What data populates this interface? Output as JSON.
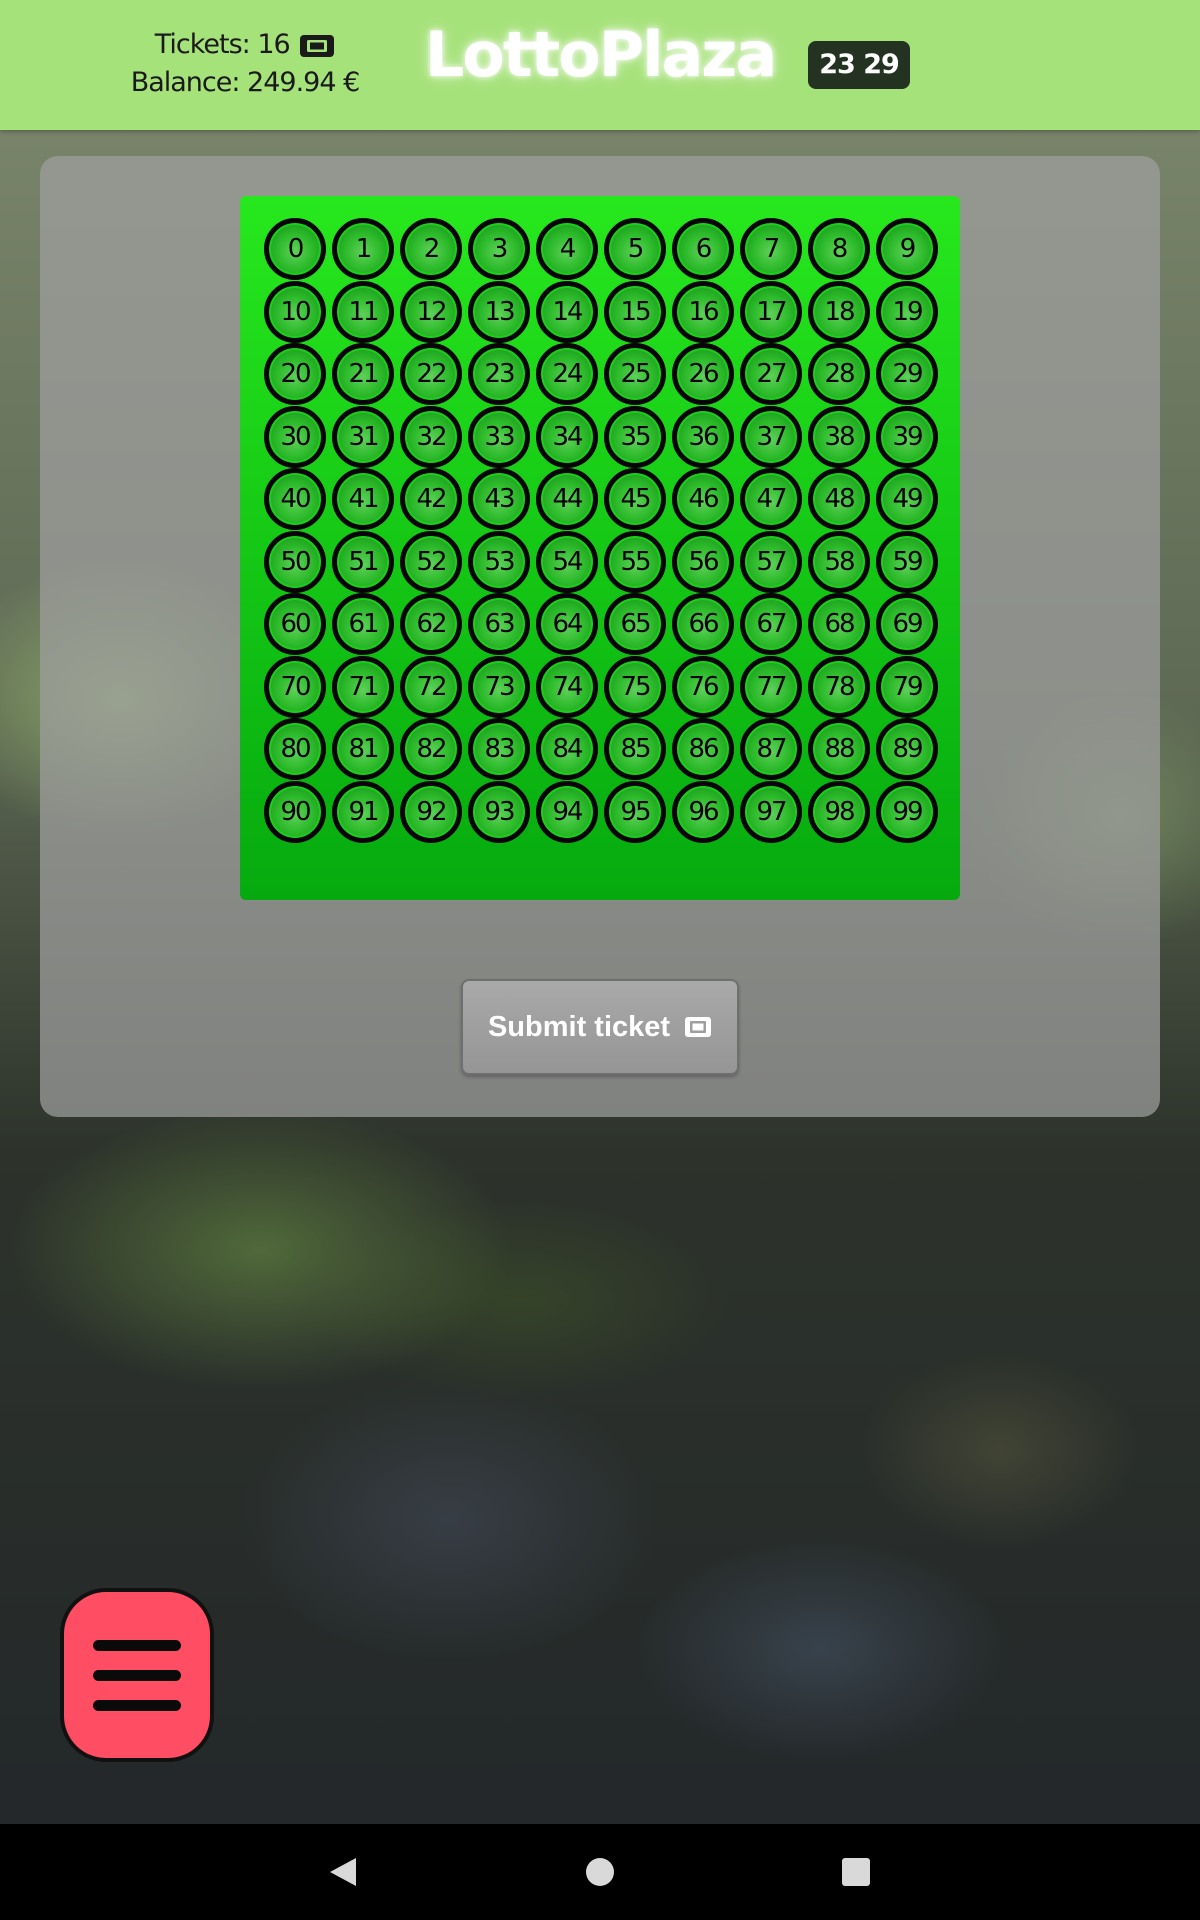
{
  "header": {
    "tickets_label": "Tickets: 16",
    "balance_label": "Balance: 249.94 €",
    "brand": "LottoPlaza",
    "clock": "23 29"
  },
  "icons": {
    "ticket": "ticket-icon",
    "menu": "hamburger-menu-icon",
    "back": "back-icon",
    "home": "home-icon",
    "recent": "recent-apps-icon"
  },
  "numbers": [
    "0",
    "1",
    "2",
    "3",
    "4",
    "5",
    "6",
    "7",
    "8",
    "9",
    "10",
    "11",
    "12",
    "13",
    "14",
    "15",
    "16",
    "17",
    "18",
    "19",
    "20",
    "21",
    "22",
    "23",
    "24",
    "25",
    "26",
    "27",
    "28",
    "29",
    "30",
    "31",
    "32",
    "33",
    "34",
    "35",
    "36",
    "37",
    "38",
    "39",
    "40",
    "41",
    "42",
    "43",
    "44",
    "45",
    "46",
    "47",
    "48",
    "49",
    "50",
    "51",
    "52",
    "53",
    "54",
    "55",
    "56",
    "57",
    "58",
    "59",
    "60",
    "61",
    "62",
    "63",
    "64",
    "65",
    "66",
    "67",
    "68",
    "69",
    "70",
    "71",
    "72",
    "73",
    "74",
    "75",
    "76",
    "77",
    "78",
    "79",
    "80",
    "81",
    "82",
    "83",
    "84",
    "85",
    "86",
    "87",
    "88",
    "89",
    "90",
    "91",
    "92",
    "93",
    "94",
    "95",
    "96",
    "97",
    "98",
    "99"
  ],
  "submit": {
    "label": "Submit ticket"
  },
  "colors": {
    "header_bg": "#a6e27a",
    "board_green": "#15c815",
    "menu_button": "#ff4e63",
    "clock_bg": "#243321"
  }
}
